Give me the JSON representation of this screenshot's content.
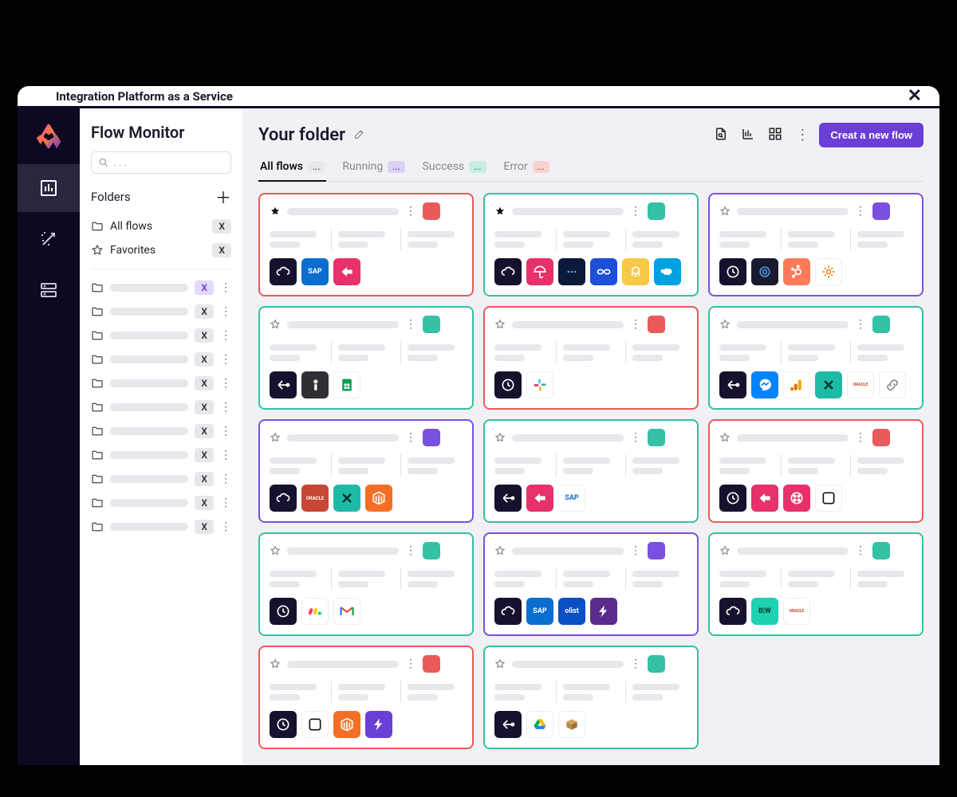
{
  "titlebar": {
    "title": "Integration Platform as a Service"
  },
  "rail": {
    "items": [
      {
        "name": "logo",
        "type": "logo"
      },
      {
        "name": "monitor",
        "active": true
      },
      {
        "name": "wand",
        "active": false
      },
      {
        "name": "db",
        "active": false
      }
    ]
  },
  "sidebar": {
    "title": "Flow Monitor",
    "search_placeholder": ". . .",
    "folders_label": "Folders",
    "fixed": [
      {
        "icon": "folder",
        "label": "All flows",
        "badge": "X",
        "badge_style": "default"
      },
      {
        "icon": "star",
        "label": "Favorites",
        "badge": "X",
        "badge_style": "default"
      }
    ],
    "folders": [
      {
        "badge": "X",
        "badge_style": "purple"
      },
      {
        "badge": "X"
      },
      {
        "badge": "X"
      },
      {
        "badge": "X"
      },
      {
        "badge": "X"
      },
      {
        "badge": "X"
      },
      {
        "badge": "X"
      },
      {
        "badge": "X"
      },
      {
        "badge": "X"
      },
      {
        "badge": "X"
      },
      {
        "badge": "X"
      }
    ]
  },
  "main": {
    "title": "Your folder",
    "create_button": "Creat a new flow",
    "tabs": [
      {
        "label": "All flows",
        "chip": "...",
        "chip_style": "default",
        "active": true
      },
      {
        "label": "Running",
        "chip": "...",
        "chip_style": "purple",
        "active": false
      },
      {
        "label": "Success",
        "chip": "...",
        "chip_style": "teal",
        "active": false
      },
      {
        "label": "Error",
        "chip": "...",
        "chip_style": "red",
        "active": false
      }
    ],
    "cards": [
      {
        "border": "red",
        "status": "red",
        "starred": true,
        "icons": [
          {
            "bg": "#17112e",
            "glyph": "cloud"
          },
          {
            "bg": "#0a6ed1",
            "text": "SAP",
            "fs": 9
          },
          {
            "bg": "#e6316b",
            "glyph": "arrow"
          }
        ]
      },
      {
        "border": "teal",
        "status": "teal",
        "starred": true,
        "icons": [
          {
            "bg": "#17112e",
            "glyph": "cloud"
          },
          {
            "bg": "#e6316b",
            "glyph": "umbrella"
          },
          {
            "bg": "#0c1a3a",
            "glyph": "dots"
          },
          {
            "bg": "#1e4fd6",
            "glyph": "link2"
          },
          {
            "bg": "#f7c948",
            "glyph": "mc"
          },
          {
            "bg": "#00a1e0",
            "glyph": "sf"
          }
        ]
      },
      {
        "border": "purple",
        "status": "purple",
        "starred": false,
        "icons": [
          {
            "bg": "#17112e",
            "glyph": "clock"
          },
          {
            "bg": "#1a1a2e",
            "glyph": "ibm"
          },
          {
            "bg": "#ff7a59",
            "glyph": "hs"
          },
          {
            "bg": "#fff",
            "glyph": "gear",
            "fg": "#f58020",
            "bd": "#eee"
          }
        ]
      },
      {
        "border": "teal",
        "status": "teal",
        "starred": false,
        "icons": [
          {
            "bg": "#17112e",
            "glyph": "share"
          },
          {
            "bg": "#2f2f36",
            "glyph": "indeed"
          },
          {
            "bg": "#fff",
            "glyph": "gsheet",
            "bd": "#eee"
          }
        ]
      },
      {
        "border": "red",
        "status": "red",
        "starred": false,
        "icons": [
          {
            "bg": "#17112e",
            "glyph": "clock"
          },
          {
            "bg": "#fff",
            "glyph": "slack",
            "bd": "#eee"
          }
        ]
      },
      {
        "border": "teal",
        "status": "teal",
        "starred": false,
        "icons": [
          {
            "bg": "#17112e",
            "glyph": "share"
          },
          {
            "bg": "#0084ff",
            "glyph": "msgr"
          },
          {
            "bg": "#fff",
            "glyph": "ga",
            "bd": "#eee"
          },
          {
            "bg": "#1fbaa6",
            "glyph": "x"
          },
          {
            "bg": "#fff",
            "text": "ORACLE",
            "fg": "#c74634",
            "bd": "#eee",
            "fs": 5
          },
          {
            "bg": "#fff",
            "glyph": "chain",
            "bd": "#eee",
            "fg": "#888"
          }
        ]
      },
      {
        "border": "purple",
        "status": "purple",
        "starred": false,
        "icons": [
          {
            "bg": "#17112e",
            "glyph": "cloud"
          },
          {
            "bg": "#c74634",
            "text": "ORACLE",
            "fs": 6
          },
          {
            "bg": "#1fbaa6",
            "glyph": "x"
          },
          {
            "bg": "#f46f25",
            "glyph": "magento"
          }
        ]
      },
      {
        "border": "teal",
        "status": "teal",
        "starred": false,
        "icons": [
          {
            "bg": "#17112e",
            "glyph": "share"
          },
          {
            "bg": "#e6316b",
            "glyph": "arrow"
          },
          {
            "bg": "#fff",
            "text": "SAP",
            "fg": "#0a6ed1",
            "bd": "#eee",
            "fs": 9
          }
        ]
      },
      {
        "border": "red",
        "status": "red",
        "starred": false,
        "icons": [
          {
            "bg": "#17112e",
            "glyph": "clock"
          },
          {
            "bg": "#e6316b",
            "glyph": "arrow"
          },
          {
            "bg": "#e6316b",
            "glyph": "twilio"
          },
          {
            "bg": "#fff",
            "glyph": "intercom",
            "bd": "#eee",
            "fg": "#111"
          }
        ]
      },
      {
        "border": "teal",
        "status": "teal",
        "starred": false,
        "icons": [
          {
            "bg": "#17112e",
            "glyph": "clock"
          },
          {
            "bg": "#fff",
            "glyph": "monday",
            "bd": "#eee"
          },
          {
            "bg": "#fff",
            "glyph": "gmail",
            "bd": "#eee"
          }
        ]
      },
      {
        "border": "purple",
        "status": "purple",
        "starred": false,
        "icons": [
          {
            "bg": "#17112e",
            "glyph": "cloud"
          },
          {
            "bg": "#0a6ed1",
            "text": "SAP",
            "fs": 9
          },
          {
            "bg": "#0a4fc4",
            "text": "olist",
            "fs": 9
          },
          {
            "bg": "#5b2b8c",
            "glyph": "bolt"
          }
        ]
      },
      {
        "border": "teal",
        "status": "teal",
        "starred": false,
        "icons": [
          {
            "bg": "#17112e",
            "glyph": "cloud"
          },
          {
            "bg": "#1ed1b1",
            "text": "B|W",
            "fs": 9,
            "fg": "#06362d"
          },
          {
            "bg": "#fff",
            "text": "ORACLE",
            "fg": "#c74634",
            "bd": "#eee",
            "fs": 5
          }
        ]
      },
      {
        "border": "red",
        "status": "red",
        "starred": false,
        "icons": [
          {
            "bg": "#17112e",
            "glyph": "clock"
          },
          {
            "bg": "#fff",
            "glyph": "intercom",
            "bd": "#eee",
            "fg": "#111"
          },
          {
            "bg": "#f46f25",
            "glyph": "magento"
          },
          {
            "bg": "#6b3fd6",
            "glyph": "bolt"
          }
        ]
      },
      {
        "border": "teal",
        "status": "teal",
        "starred": false,
        "icons": [
          {
            "bg": "#17112e",
            "glyph": "share"
          },
          {
            "bg": "#fff",
            "glyph": "gdrive",
            "bd": "#eee"
          },
          {
            "bg": "#fff",
            "glyph": "box",
            "bd": "#eee"
          }
        ]
      }
    ]
  }
}
